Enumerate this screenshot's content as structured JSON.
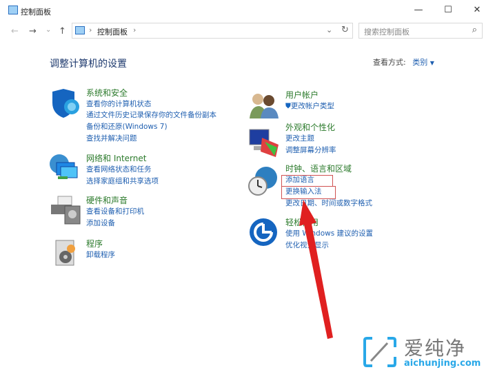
{
  "window": {
    "title": "控制面板",
    "minimize": "—",
    "maximize": "☐",
    "close": "✕"
  },
  "nav": {
    "back": "←",
    "forward": "→",
    "recent": "⌄",
    "up": "↑",
    "breadcrumb": [
      "›",
      "控制面板",
      "›"
    ],
    "dropdown": "⌄",
    "refresh": "↻",
    "search_placeholder": "搜索控制面板",
    "search_icon": "⌕"
  },
  "main": {
    "heading": "调整计算机的设置",
    "view_by_label": "查看方式:",
    "view_by_value": "类别",
    "view_by_arrow": "▼"
  },
  "categories": [
    {
      "title": "系统和安全",
      "links": [
        "查看你的计算机状态",
        "通过文件历史记录保存你的文件备份副本",
        "备份和还原(Windows 7)",
        "查找并解决问题"
      ]
    },
    {
      "title": "网络和 Internet",
      "links": [
        "查看网络状态和任务",
        "选择家庭组和共享选项"
      ]
    },
    {
      "title": "硬件和声音",
      "links": [
        "查看设备和打印机",
        "添加设备"
      ]
    },
    {
      "title": "程序",
      "links": [
        "卸载程序"
      ]
    },
    {
      "title": "用户帐户",
      "links": [
        "更改帐户类型"
      ]
    },
    {
      "title": "外观和个性化",
      "links": [
        "更改主题",
        "调整屏幕分辨率"
      ]
    },
    {
      "title": "时钟、语言和区域",
      "links": [
        "添加语言",
        "更换输入法",
        "更改日期、时间或数字格式"
      ]
    },
    {
      "title": "轻松使用",
      "links": [
        "使用 Windows 建议的设置",
        "优化视觉显示"
      ]
    }
  ],
  "watermark": {
    "name": "爱纯净",
    "domain": "aichunjing.com"
  },
  "colors": {
    "link": "#1f5fb0",
    "category": "#2b7a2b",
    "highlight": "#d05050",
    "arrow": "#e02020"
  }
}
